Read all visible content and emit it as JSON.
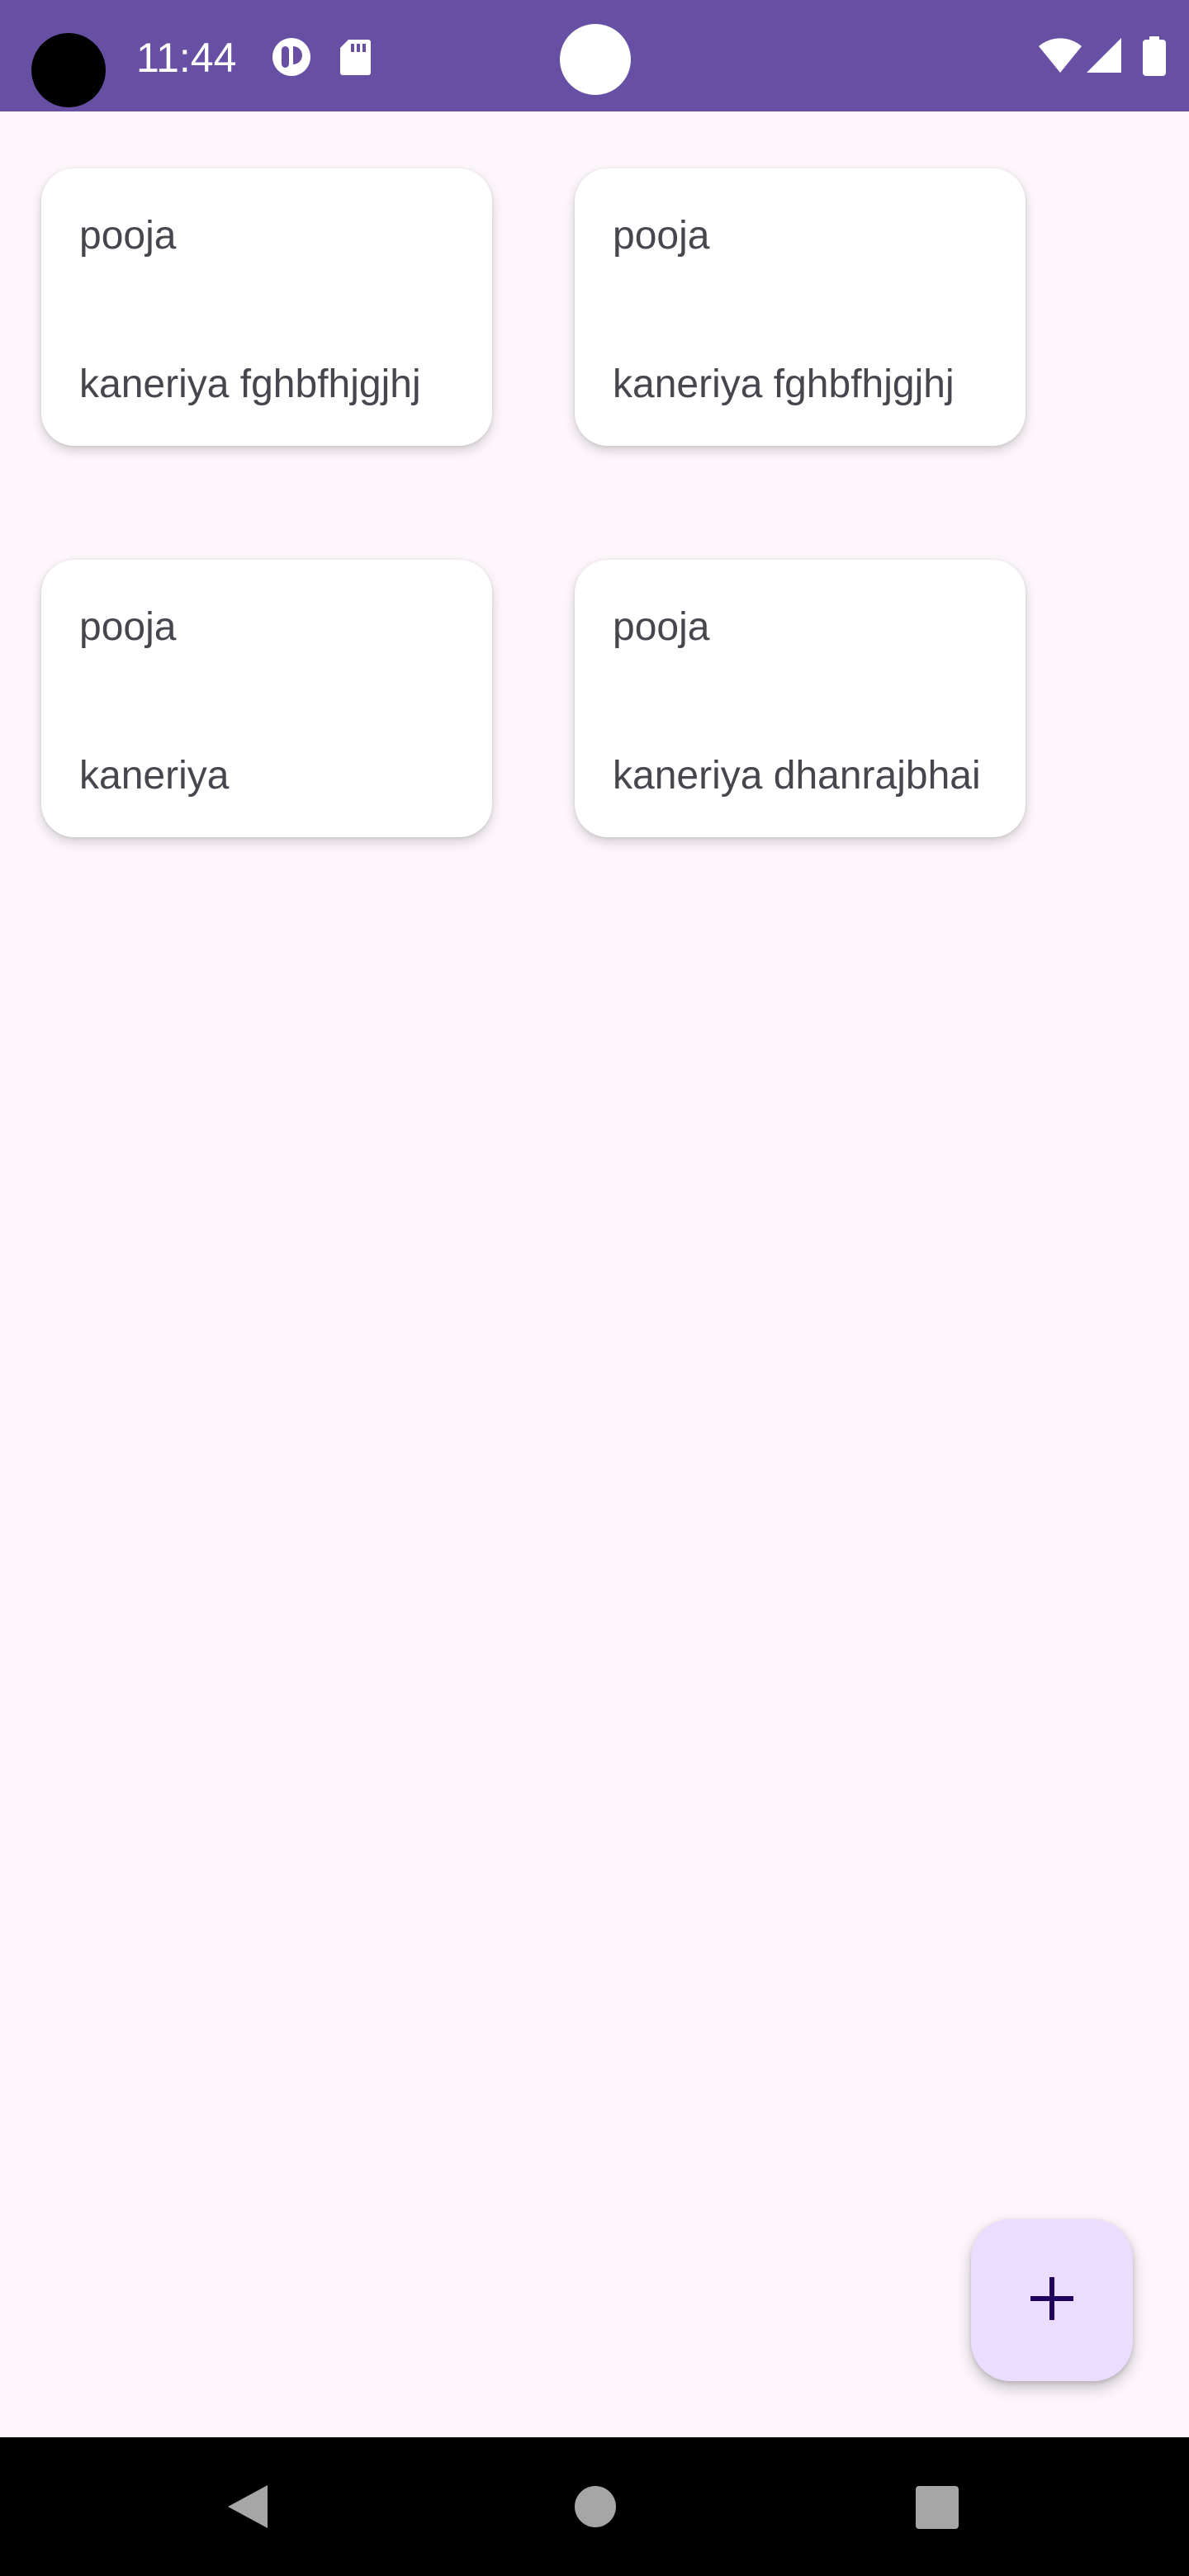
{
  "status_bar": {
    "time": "11:44",
    "background_color": "#6750a4",
    "icons": [
      "camera-cutout-icon",
      "notification-app-icon",
      "sd-card-icon",
      "wifi-icon",
      "signal-icon",
      "battery-icon"
    ]
  },
  "notes": [
    {
      "title": "pooja",
      "body": "kaneriya fghbfhjgjhj"
    },
    {
      "title": "pooja",
      "body": "kaneriya fghbfhjgjhj"
    },
    {
      "title": "pooja",
      "body": "kaneriya"
    },
    {
      "title": "pooja",
      "body": "kaneriya dhanrajbhai"
    }
  ],
  "fab": {
    "icon": "plus-icon",
    "background_color": "#eaddff",
    "icon_color": "#21005d"
  },
  "navigation_bar": {
    "buttons": [
      "back-icon",
      "home-icon",
      "recents-icon"
    ]
  }
}
